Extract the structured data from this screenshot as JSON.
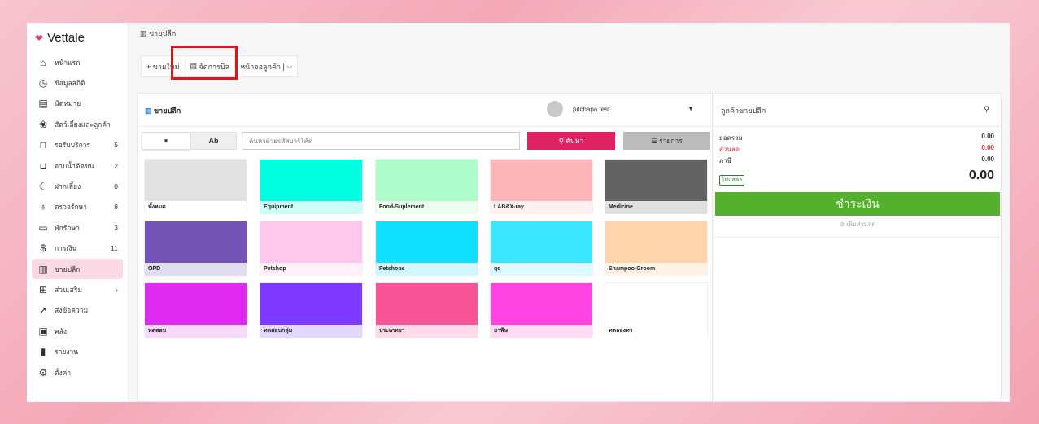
{
  "app": {
    "name": "Vettale"
  },
  "sidebar": {
    "items": [
      {
        "icon": "home-icon",
        "glyph": "⌂",
        "label": "หน้าแรก",
        "count": ""
      },
      {
        "icon": "stats-icon",
        "glyph": "◷",
        "label": "ข้อมูลสถิติ",
        "count": ""
      },
      {
        "icon": "calendar-icon",
        "glyph": "▤",
        "label": "นัดหมาย",
        "count": ""
      },
      {
        "icon": "paw-icon",
        "glyph": "❀",
        "label": "สัตว์เลี้ยงและลูกค้า",
        "count": ""
      },
      {
        "icon": "sofa-icon",
        "glyph": "⊓",
        "label": "รอรับบริการ",
        "count": "5"
      },
      {
        "icon": "bath-icon",
        "glyph": "⊔",
        "label": "อาบน้ำตัดขน",
        "count": "2"
      },
      {
        "icon": "moon-icon",
        "glyph": "☾",
        "label": "ฝากเลี้ยง",
        "count": "0"
      },
      {
        "icon": "stethoscope-icon",
        "glyph": "♁",
        "label": "ตรวจรักษา",
        "count": "8"
      },
      {
        "icon": "bed-icon",
        "glyph": "▭",
        "label": "พักรักษา",
        "count": "3"
      },
      {
        "icon": "payment-icon",
        "glyph": "$",
        "label": "การเงิน",
        "count": "11"
      },
      {
        "icon": "register-icon",
        "glyph": "▥",
        "label": "ขายปลีก",
        "count": ""
      },
      {
        "icon": "plus-square-icon",
        "glyph": "⊞",
        "label": "ส่วนเสริม",
        "count": "›"
      },
      {
        "icon": "send-icon",
        "glyph": "➚",
        "label": "ส่งข้อความ",
        "count": ""
      },
      {
        "icon": "archive-icon",
        "glyph": "▣",
        "label": "คลัง",
        "count": ""
      },
      {
        "icon": "report-icon",
        "glyph": "▮",
        "label": "รายงาน",
        "count": ""
      },
      {
        "icon": "gear-icon",
        "glyph": "⚙",
        "label": "ตั้งค่า",
        "count": ""
      }
    ]
  },
  "header": {
    "breadcrumb": "ขายปลีก"
  },
  "toolbar": {
    "new_sale": "+ ขายใหม่",
    "manage_bill": "จัดการบิล",
    "customer_screen": "หน้าจอลูกค้า |"
  },
  "panel": {
    "title": "ขายปลีก",
    "user_name": "pitchapa test",
    "view_grid": "⏸",
    "view_ab": "Ab",
    "search_placeholder": "ค้นหาด้วยรหัสบาร์โค้ด",
    "search_button": "ค้นหา",
    "list_button": "☰ รายการ"
  },
  "tiles": [
    {
      "label": "ทั้งหมด",
      "color": "#e2e2e2",
      "bg": "#ffffff"
    },
    {
      "label": "Equipment",
      "color": "#00ffe0",
      "bg": "#ccfdf8"
    },
    {
      "label": "Food-Suplement",
      "color": "#aefcca",
      "bg": "#eafff0"
    },
    {
      "label": "LAB&X-ray",
      "color": "#ffb6b9",
      "bg": "#fff0f0"
    },
    {
      "label": "Medicine",
      "color": "#626262",
      "bg": "#e0e0e0"
    },
    {
      "label": "OPD",
      "color": "#7353b6",
      "bg": "#e2dcf0"
    },
    {
      "label": "Petshop",
      "color": "#ffc6ee",
      "bg": "#fff0fa"
    },
    {
      "label": "Petshops",
      "color": "#10dfff",
      "bg": "#d0f7ff"
    },
    {
      "label": "qq",
      "color": "#3be7ff",
      "bg": "#dcf9ff"
    },
    {
      "label": "Shampoo-Groom",
      "color": "#ffd4aa",
      "bg": "#fff3e6"
    },
    {
      "label": "ทดสอบ",
      "color": "#e029f3",
      "bg": "#f8d8fb"
    },
    {
      "label": "ทดสอบกลุ่ม",
      "color": "#7d39ff",
      "bg": "#e3d8ff"
    },
    {
      "label": "ประเภทยา",
      "color": "#f95498",
      "bg": "#ffdbe9"
    },
    {
      "label": "ยาพิษ",
      "color": "#ff45e1",
      "bg": "#ffdaf7"
    },
    {
      "label": "ทดลองทา",
      "color": "#ffffff",
      "bg": "#ffffff"
    }
  ],
  "summary": {
    "title": "ลูกค้าขายปลีก",
    "subtotal_label": "ยอดรวม",
    "subtotal_value": "0.00",
    "discount_label": "ส่วนลด",
    "discount_value": "0.00",
    "tax_label": "ภาษี",
    "tax_value": "0.00",
    "badge": "ไม่แสดง",
    "total": "0.00",
    "pay_button": "ชำระเงิน",
    "add_discount": "⊘ เพิ่มส่วนลด"
  }
}
